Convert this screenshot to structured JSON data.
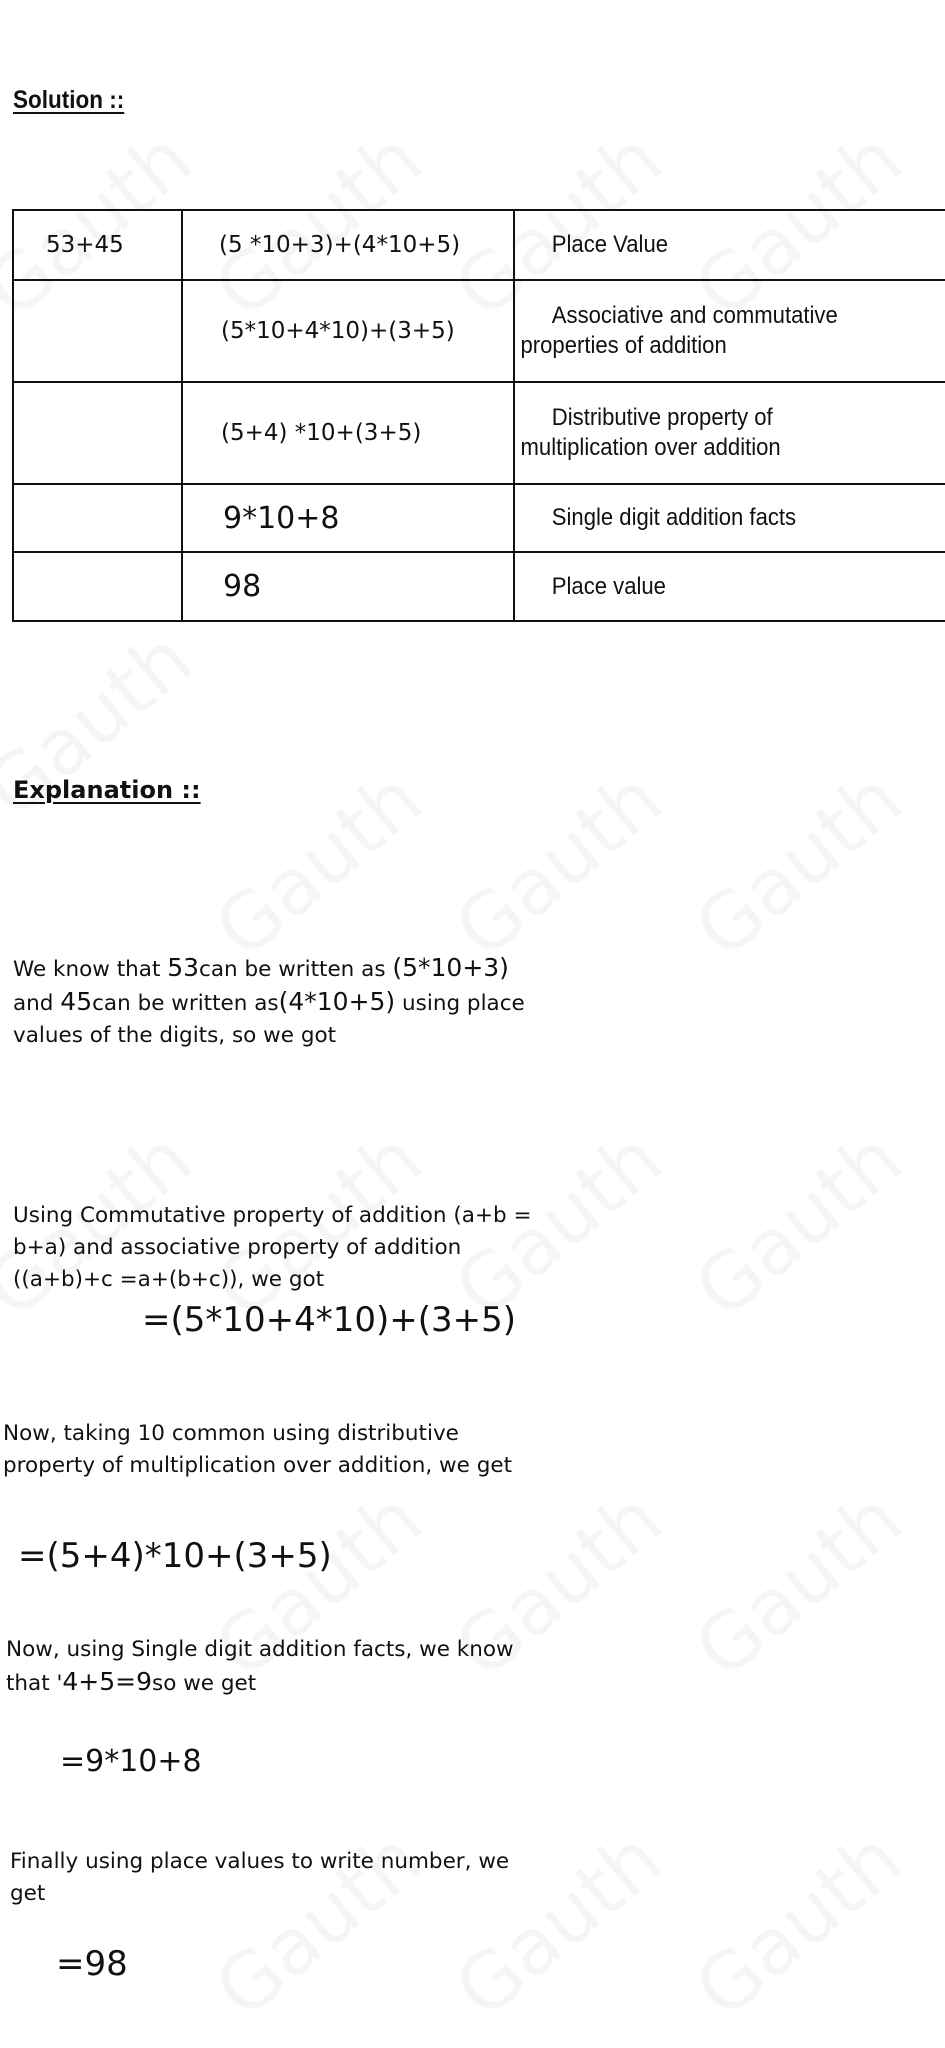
{
  "watermark": "Gauth",
  "solution": {
    "title": "Solution ::",
    "table": {
      "rows": [
        {
          "col1": "53+45",
          "col2": "(5 *10+3)+(4*10+5)",
          "col3": "Place Value"
        },
        {
          "col1": "",
          "col2": "(5*10+4*10)+(3+5)",
          "col3_line1": "Associative and commutative",
          "col3_line2": "properties of addition"
        },
        {
          "col1": "",
          "col2": "(5+4) *10+(3+5)",
          "col3_line1": "Distributive property of",
          "col3_line2": "multiplication over addition"
        },
        {
          "col1": "",
          "col2": "9*10+8",
          "col3": "Single digit addition facts"
        },
        {
          "col1": "",
          "col2": "98",
          "col3": "Place value"
        }
      ]
    }
  },
  "explanation": {
    "title": "Explanation ::",
    "p1": {
      "a": "We know that ",
      "n1": "53",
      "b": "can be written as ",
      "e1": "(5*10+3)",
      "c": "and ",
      "n2": "45",
      "d": "can be written as",
      "e2": "(4*10+5)",
      "f": " using place",
      "g": "values of the digits, so we got"
    },
    "p2": {
      "line1": "Using Commutative property of addition (a+b =",
      "line2": "b+a) and associative property of addition",
      "line3": "((a+b)+c =a+(b+c)), we got",
      "eq": "=(5*10+4*10)+(3+5)"
    },
    "p3": {
      "line1": "Now, taking 10 common using distributive",
      "line2": "property of multiplication over addition, we get",
      "eq": "=(5+4)*10+(3+5)"
    },
    "p4": {
      "line1": "Now, using Single digit addition facts, we know",
      "line2a": "that '",
      "line2b": "4+5=9",
      "line2c": "so we get",
      "eq": "=9*10+8"
    },
    "p5": {
      "line1": "Finally using place values to write number, we",
      "line2": "get",
      "eq": "=98"
    }
  }
}
